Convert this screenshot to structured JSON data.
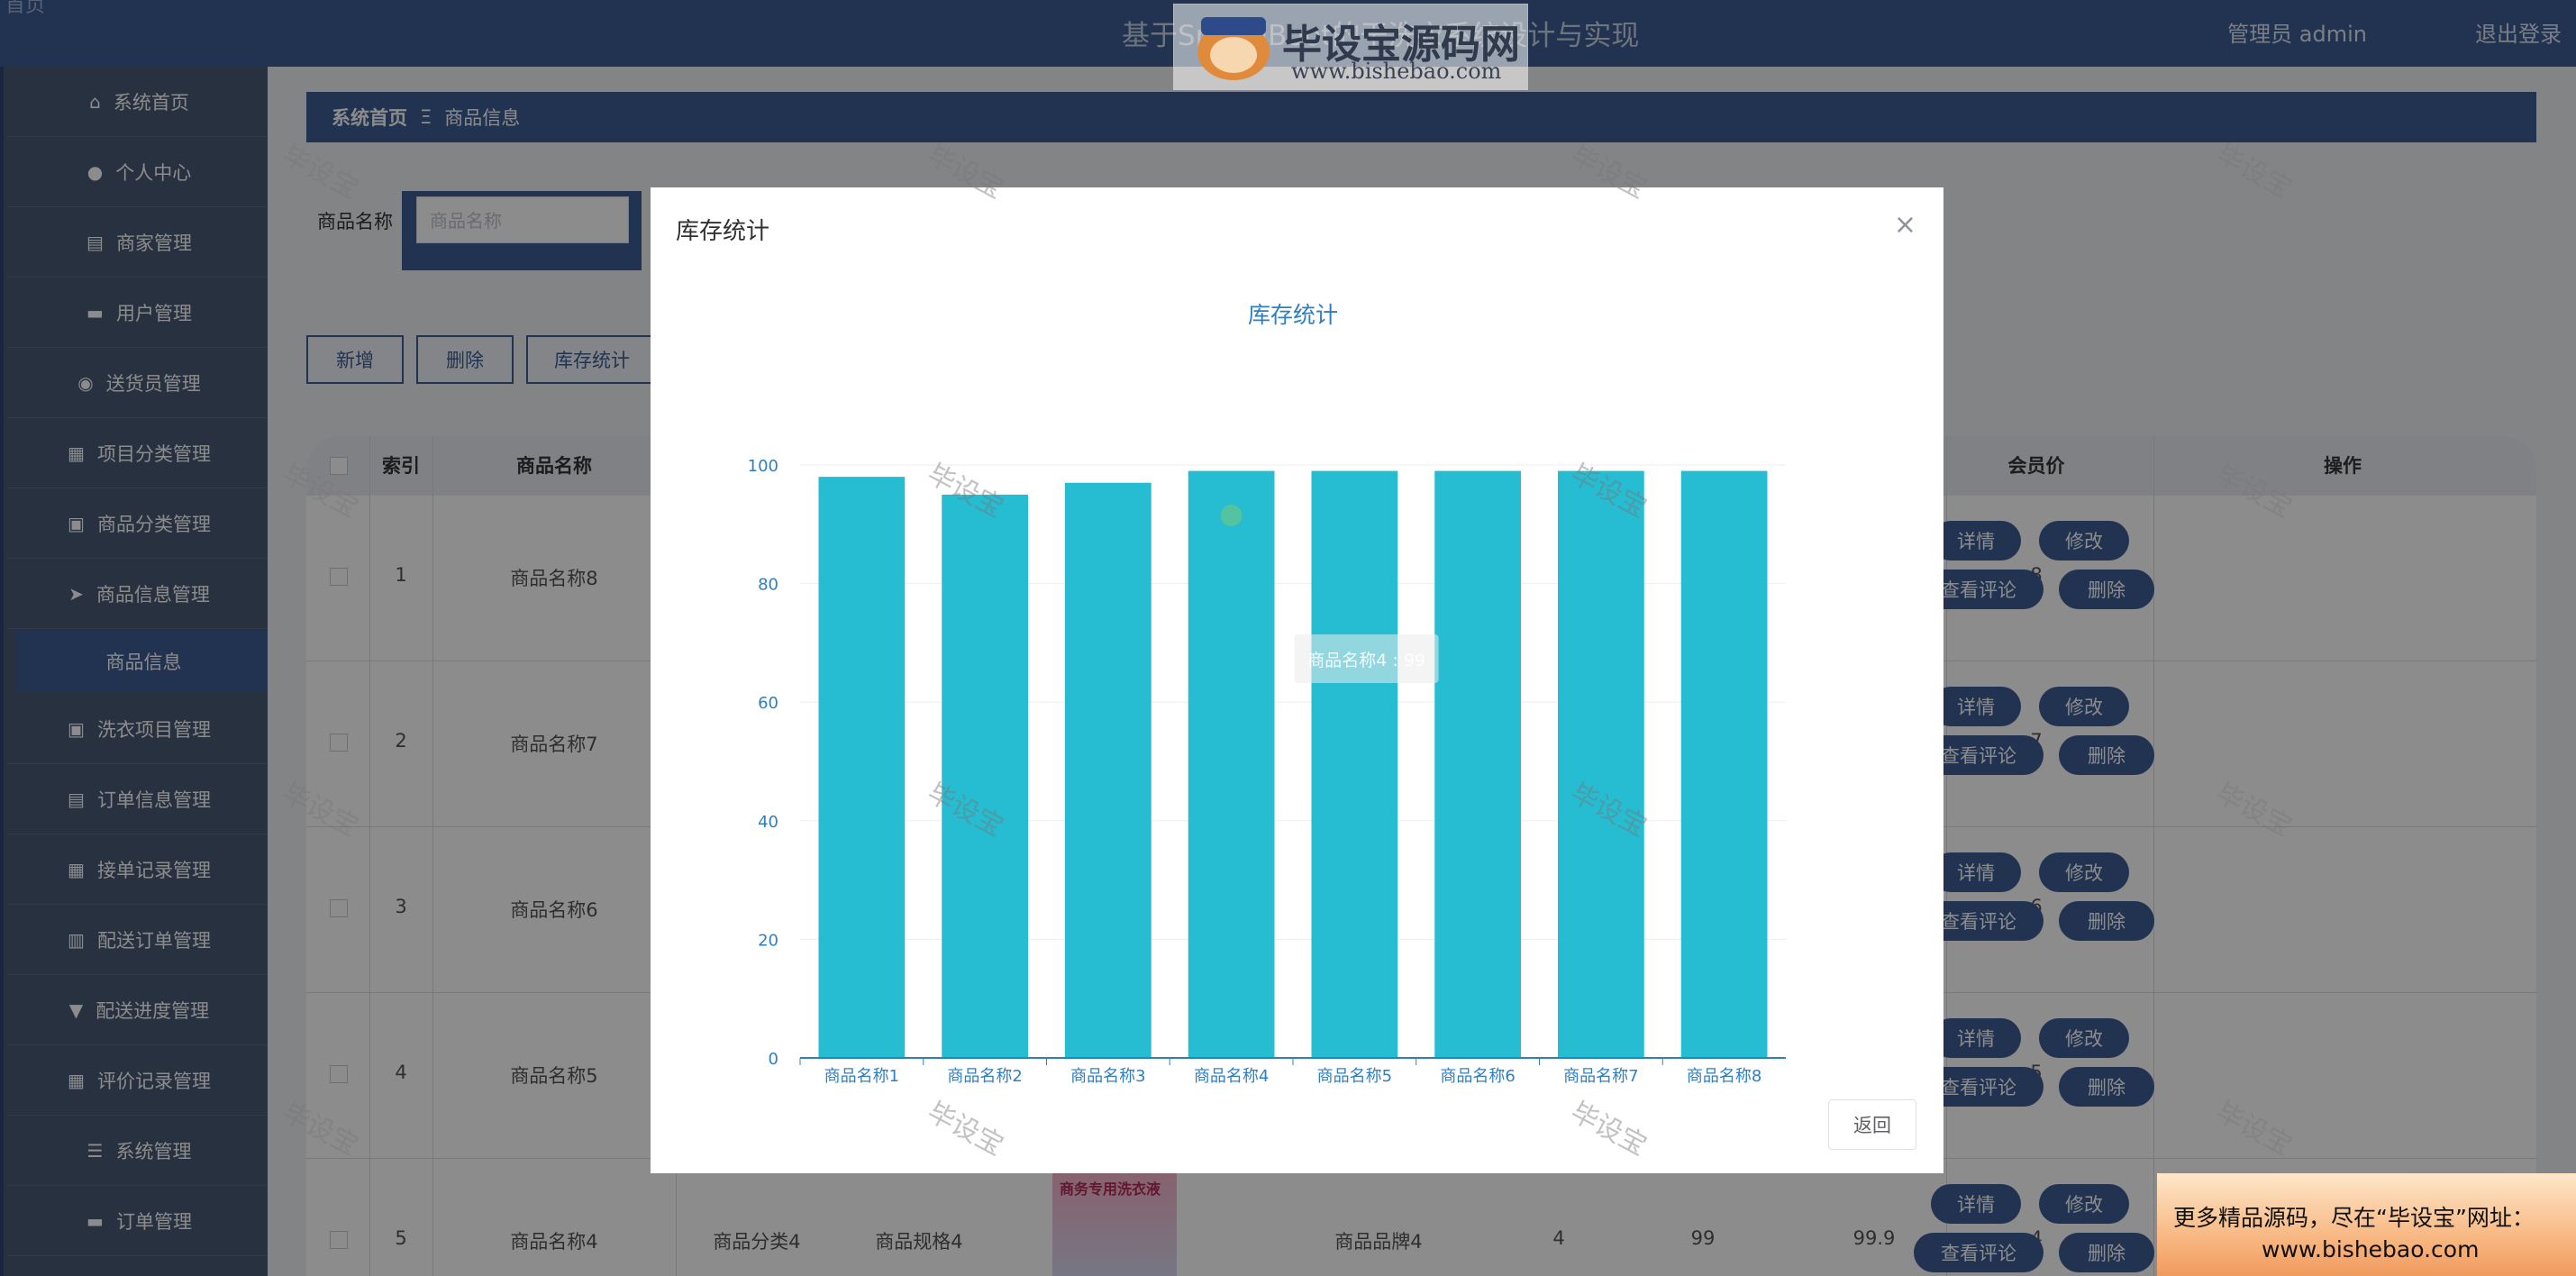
{
  "header": {
    "title": "基于SpringBoot的干洗衣系统设计与实现",
    "left_text": "首页",
    "user": "管理员 admin",
    "logout": "退出登录"
  },
  "watermark": {
    "brand": "毕设宝源码网",
    "url": "www.bishebao.com",
    "tile": "毕设宝",
    "promo_line1": "更多精品源码，尽在“毕设宝”网址：",
    "promo_line2": "www.bishebao.com"
  },
  "sidebar": {
    "items": [
      {
        "label": "系统首页",
        "icon": "home-icon",
        "glyph": "⌂"
      },
      {
        "label": "个人中心",
        "icon": "user-icon",
        "glyph": "●"
      },
      {
        "label": "商家管理",
        "icon": "chart-icon",
        "glyph": "▤"
      },
      {
        "label": "用户管理",
        "icon": "users-icon",
        "glyph": "▬"
      },
      {
        "label": "送货员管理",
        "icon": "location-icon",
        "glyph": "◉"
      },
      {
        "label": "项目分类管理",
        "icon": "grid-icon",
        "glyph": "▦"
      },
      {
        "label": "商品分类管理",
        "icon": "clipboard-icon",
        "glyph": "▣"
      },
      {
        "label": "商品信息管理",
        "icon": "send-icon",
        "glyph": "➤"
      },
      {
        "label": "洗衣项目管理",
        "icon": "clipboard-check-icon",
        "glyph": "▣"
      },
      {
        "label": "订单信息管理",
        "icon": "briefcase-icon",
        "glyph": "▤"
      },
      {
        "label": "接单记录管理",
        "icon": "grid-icon",
        "glyph": "▦"
      },
      {
        "label": "配送订单管理",
        "icon": "book-icon",
        "glyph": "▥"
      },
      {
        "label": "配送进度管理",
        "icon": "trophy-icon",
        "glyph": "▼"
      },
      {
        "label": "评价记录管理",
        "icon": "grid-icon",
        "glyph": "▦"
      },
      {
        "label": "系统管理",
        "icon": "sliders-icon",
        "glyph": "☰"
      },
      {
        "label": "订单管理",
        "icon": "message-icon",
        "glyph": "▬"
      }
    ],
    "sub_item": "商品信息"
  },
  "breadcrumb": {
    "home": "系统首页",
    "sep": "Ξ",
    "current": "商品信息"
  },
  "search": {
    "label": "商品名称",
    "placeholder": "商品名称"
  },
  "toolbar": {
    "add": "新增",
    "delete": "删除",
    "stats": "库存统计"
  },
  "table": {
    "headers": {
      "index": "索引",
      "name": "商品名称",
      "member_price": "会员价",
      "ops": "操作"
    },
    "rows": [
      {
        "index": "1",
        "name": "商品名称8",
        "member": "8"
      },
      {
        "index": "2",
        "name": "商品名称7",
        "member": "7"
      },
      {
        "index": "3",
        "name": "商品名称6",
        "member": "6"
      },
      {
        "index": "4",
        "name": "商品名称5",
        "member": "5"
      },
      {
        "index": "5",
        "name": "商品名称4",
        "category": "商品分类4",
        "spec": "商品规格4",
        "brand": "商品品牌4",
        "c1": "4",
        "c2": "99",
        "c3": "99.9",
        "member": "4"
      }
    ],
    "ops": {
      "detail": "详情",
      "edit": "修改",
      "comments": "查看评论",
      "remove": "删除"
    }
  },
  "dialog": {
    "title": "库存统计",
    "close": "×",
    "back": "返回"
  },
  "chart_data": {
    "type": "bar",
    "title": "库存统计",
    "categories": [
      "商品名称1",
      "商品名称2",
      "商品名称3",
      "商品名称4",
      "商品名称5",
      "商品名称6",
      "商品名称7",
      "商品名称8"
    ],
    "values": [
      98,
      95,
      97,
      99,
      99,
      99,
      99,
      99
    ],
    "ylim": [
      0,
      100
    ],
    "yticks": [
      0,
      20,
      40,
      60,
      80,
      100
    ],
    "tooltip": "商品名称4 : 99",
    "color": "#26bcd1",
    "grid": true
  }
}
